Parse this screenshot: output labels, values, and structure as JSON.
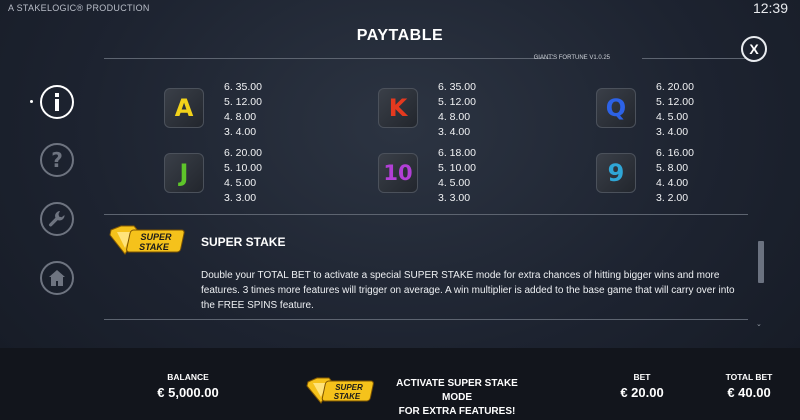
{
  "header": {
    "producer": "A STAKELOGIC® PRODUCTION",
    "clock": "12:39",
    "title": "PAYTABLE",
    "version": "GIANT'S FORTUNE V1.0.25",
    "close_label": "X"
  },
  "side_nav": [
    {
      "name": "info-icon",
      "active": true
    },
    {
      "name": "help-icon",
      "active": false
    },
    {
      "name": "settings-wrench-icon",
      "active": false
    },
    {
      "name": "home-icon",
      "active": false
    }
  ],
  "paytable": {
    "symbols": [
      {
        "glyph": "A",
        "color": "#f2d21a",
        "pays": [
          "6. 35.00",
          "5. 12.00",
          "4. 8.00",
          "3. 4.00"
        ]
      },
      {
        "glyph": "K",
        "color": "#e4391f",
        "pays": [
          "6. 35.00",
          "5. 12.00",
          "4. 8.00",
          "3. 4.00"
        ]
      },
      {
        "glyph": "Q",
        "color": "#2d62e6",
        "pays": [
          "6. 20.00",
          "5. 12.00",
          "4. 5.00",
          "3. 4.00"
        ]
      },
      {
        "glyph": "J",
        "color": "#5ec52a",
        "pays": [
          "6. 20.00",
          "5. 10.00",
          "4. 5.00",
          "3. 3.00"
        ]
      },
      {
        "glyph": "10",
        "color": "#b23fd6",
        "pays": [
          "6. 18.00",
          "5. 10.00",
          "4. 5.00",
          "3. 3.00"
        ]
      },
      {
        "glyph": "9",
        "color": "#2fa6d6",
        "pays": [
          "6. 16.00",
          "5. 8.00",
          "4. 4.00",
          "3. 2.00"
        ]
      }
    ]
  },
  "super_stake": {
    "logo_line1": "SUPER",
    "logo_line2": "STAKE",
    "title": "SUPER STAKE",
    "description": "Double your TOTAL BET to activate a special SUPER STAKE mode for extra chances of hitting bigger wins and more features. 3 times more features will trigger on average. A win multiplier is added to the base game that will carry over into the FREE SPINS feature."
  },
  "footer": {
    "balance_label": "BALANCE",
    "balance_value": "€ 5,000.00",
    "promo_line1": "ACTIVATE SUPER STAKE MODE",
    "promo_line2": "FOR EXTRA FEATURES!",
    "bet_label": "BET",
    "bet_value": "€ 20.00",
    "total_bet_label": "TOTAL BET",
    "total_bet_value": "€ 40.00"
  },
  "colors": {
    "gold": "#f5c21b",
    "background": "#1d2330",
    "footer": "#12151c"
  }
}
